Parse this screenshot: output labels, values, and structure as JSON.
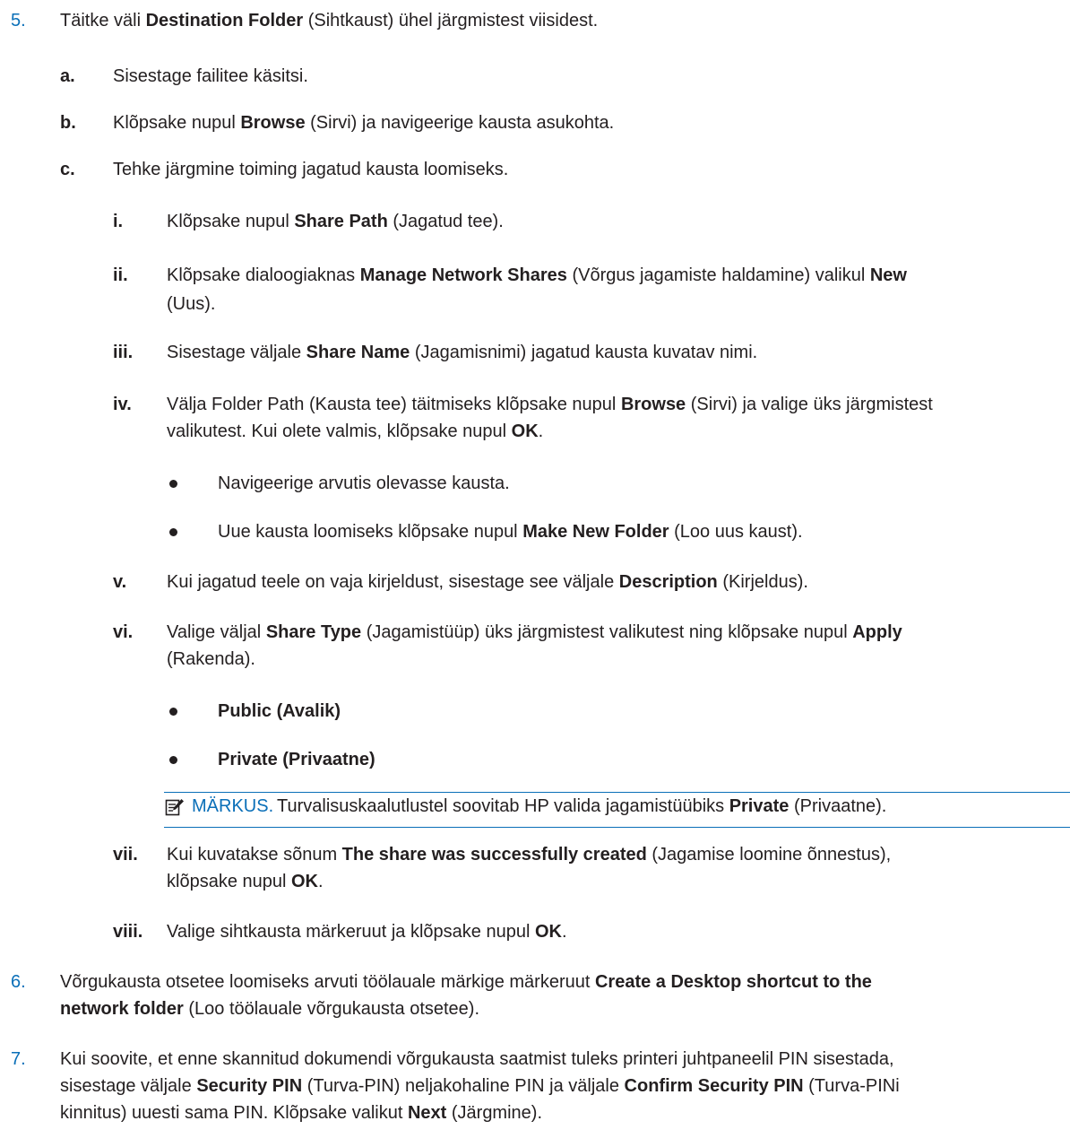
{
  "step5": {
    "num": "5.",
    "line": [
      "Täitke väli ",
      "Destination Folder",
      " (Sihtkaust) ühel järgmistest viisidest."
    ],
    "a": {
      "num": "a.",
      "text": "Sisestage failitee käsitsi."
    },
    "b": {
      "num": "b.",
      "line": [
        "Klõpsake nupul ",
        "Browse",
        " (Sirvi) ja navigeerige kausta asukohta."
      ]
    },
    "c": {
      "num": "c.",
      "text": "Tehke järgmine toiming jagatud kausta loomiseks.",
      "i": {
        "num": "i.",
        "line": [
          "Klõpsake nupul ",
          "Share Path",
          " (Jagatud tee)."
        ]
      },
      "ii": {
        "num": "ii.",
        "line1": [
          "Klõpsake dialoogiaknas ",
          "Manage Network Shares",
          " (Võrgus jagamiste haldamine) valikul ",
          "New"
        ],
        "line2": "(Uus)."
      },
      "iii": {
        "num": "iii.",
        "line": [
          "Sisestage väljale ",
          "Share Name",
          " (Jagamisnimi) jagatud kausta kuvatav nimi."
        ]
      },
      "iv": {
        "num": "iv.",
        "line1": [
          "Välja Folder Path (Kausta tee) täitmiseks klõpsake nupul ",
          "Browse",
          " (Sirvi) ja valige üks järgmistest"
        ],
        "line2": [
          "valikutest. Kui olete valmis, klõpsake nupul ",
          "OK",
          "."
        ],
        "bullets": [
          {
            "text": "Navigeerige arvutis olevasse kausta."
          },
          {
            "line": [
              "Uue kausta loomiseks klõpsake nupul ",
              "Make New Folder",
              " (Loo uus kaust)."
            ]
          }
        ]
      },
      "v": {
        "num": "v.",
        "line": [
          "Kui jagatud teele on vaja kirjeldust, sisestage see väljale ",
          "Description",
          " (Kirjeldus)."
        ]
      },
      "vi": {
        "num": "vi.",
        "line1": [
          "Valige väljal ",
          "Share Type",
          " (Jagamistüüp) üks järgmistest valikutest ning klõpsake nupul ",
          "Apply"
        ],
        "line2": "(Rakenda).",
        "bullets": [
          "Public (Avalik)",
          "Private (Privaatne)"
        ]
      },
      "note": {
        "label": "MÄRKUS.",
        "line": [
          "Turvalisuskaalutlustel soovitab HP valida jagamistüübiks ",
          "Private",
          " (Privaatne)."
        ]
      },
      "vii": {
        "num": "vii.",
        "line1": [
          "Kui kuvatakse sõnum ",
          "The share was successfully created",
          " (Jagamise loomine õnnestus),"
        ],
        "line2": [
          "klõpsake nupul ",
          "OK",
          "."
        ]
      },
      "viii": {
        "num": "viii.",
        "line": [
          "Valige sihtkausta märkeruut ja klõpsake nupul ",
          "OK",
          "."
        ]
      }
    }
  },
  "step6": {
    "num": "6.",
    "line1": [
      "Võrgukausta otsetee loomiseks arvuti töölauale märkige märkeruut ",
      "Create a Desktop shortcut to the"
    ],
    "line2": [
      "network folder",
      " (Loo töölauale võrgukausta otsetee)."
    ]
  },
  "step7": {
    "num": "7.",
    "line1": "Kui soovite, et enne skannitud dokumendi võrgukausta saatmist tuleks printeri juhtpaneelil PIN sisestada,",
    "line2": [
      "sisestage väljale ",
      "Security PIN",
      " (Turva-PIN) neljakohaline PIN ja väljale ",
      "Confirm Security PIN",
      " (Turva-PINi"
    ],
    "line3": [
      "kinnitus) uuesti sama PIN. Klõpsake valikut ",
      "Next",
      " (Järgmine)."
    ]
  },
  "colors": {
    "accent": "#0a6fb8",
    "text": "#231f20"
  },
  "icons": {
    "note": "note-pencil-icon"
  }
}
